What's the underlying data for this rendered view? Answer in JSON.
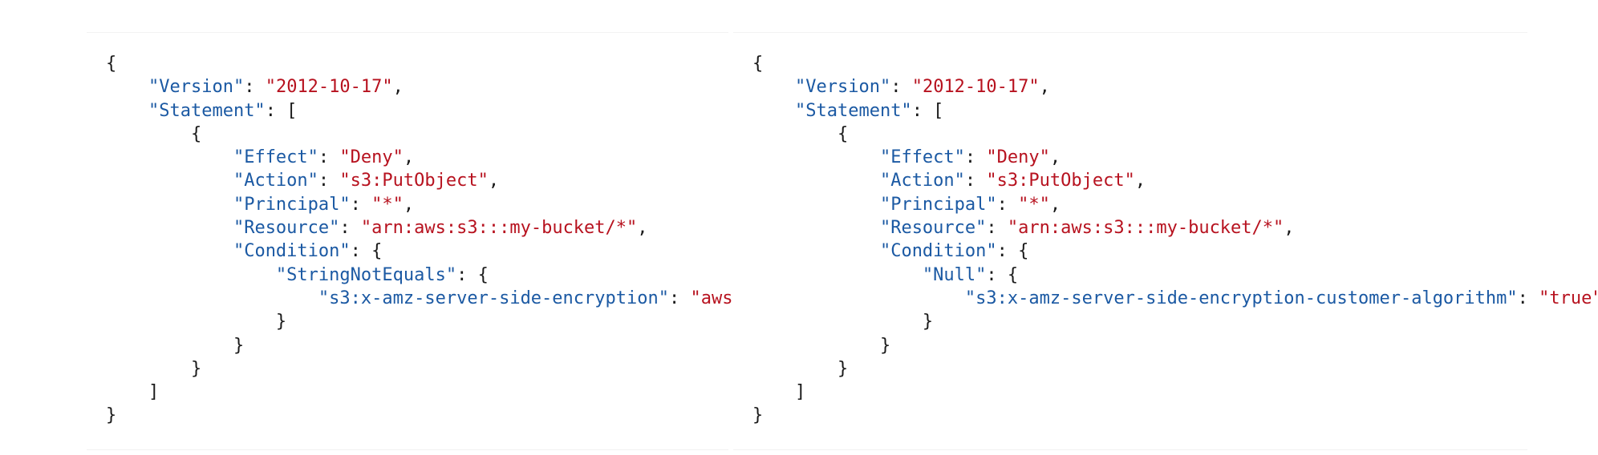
{
  "left_policy": {
    "version_key": "\"Version\"",
    "version_value": "\"2012-10-17\"",
    "statement_key": "\"Statement\"",
    "effect_key": "\"Effect\"",
    "effect_value": "\"Deny\"",
    "action_key": "\"Action\"",
    "action_value": "\"s3:PutObject\"",
    "principal_key": "\"Principal\"",
    "principal_value": "\"*\"",
    "resource_key": "\"Resource\"",
    "resource_value": "\"arn:aws:s3:::my-bucket/*\"",
    "condition_key": "\"Condition\"",
    "operator_key": "\"StringNotEquals\"",
    "condition_field": "\"s3:x-amz-server-side-encryption\"",
    "condition_value": "\"aws:kms\""
  },
  "right_policy": {
    "version_key": "\"Version\"",
    "version_value": "\"2012-10-17\"",
    "statement_key": "\"Statement\"",
    "effect_key": "\"Effect\"",
    "effect_value": "\"Deny\"",
    "action_key": "\"Action\"",
    "action_value": "\"s3:PutObject\"",
    "principal_key": "\"Principal\"",
    "principal_value": "\"*\"",
    "resource_key": "\"Resource\"",
    "resource_value": "\"arn:aws:s3:::my-bucket/*\"",
    "condition_key": "\"Condition\"",
    "operator_key": "\"Null\"",
    "condition_field": "\"s3:x-amz-server-side-encryption-customer-algorithm\"",
    "condition_value": "\"true\""
  },
  "colors": {
    "key": "#1b59a3",
    "string": "#b7121f",
    "punctuation": "#1a1a1a"
  }
}
